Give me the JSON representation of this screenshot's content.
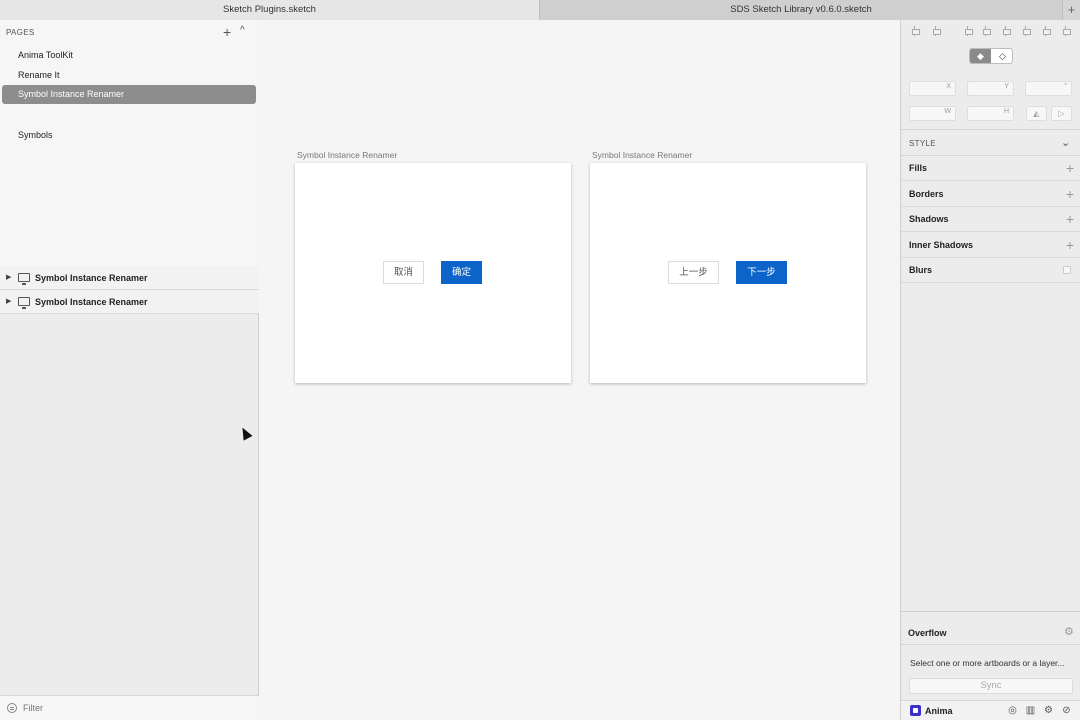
{
  "tabs": [
    {
      "label": "Sketch Plugins.sketch"
    },
    {
      "label": "SDS Sketch Library v0.6.0.sketch"
    }
  ],
  "tab_add": "+",
  "left_panel": {
    "pages_header": "PAGES",
    "pages_add": "+",
    "pages_collapse": "^",
    "pages": [
      {
        "label": "Anima ToolKit"
      },
      {
        "label": "Rename It"
      },
      {
        "label": "Symbol Instance Renamer",
        "selected": true
      },
      {
        "label": "Symbols"
      }
    ],
    "layers": [
      {
        "label": "Symbol Instance Renamer"
      },
      {
        "label": "Symbol Instance Renamer"
      }
    ],
    "filter_placeholder": "Filter"
  },
  "canvas": {
    "artboards": [
      {
        "title": "Symbol Instance Renamer",
        "secondary_label": "取消",
        "primary_label": "确定"
      },
      {
        "title": "Symbol Instance Renamer",
        "secondary_label": "上一步",
        "primary_label": "下一步"
      }
    ]
  },
  "inspector": {
    "fields": {
      "x": "X",
      "y": "Y",
      "rotation": "°",
      "w": "W",
      "h": "H"
    },
    "style_header": "STYLE",
    "sections": [
      {
        "label": "Fills",
        "action": "+"
      },
      {
        "label": "Borders",
        "action": "+"
      },
      {
        "label": "Shadows",
        "action": "+"
      },
      {
        "label": "Inner Shadows",
        "action": "+"
      },
      {
        "label": "Blurs",
        "action": ""
      }
    ],
    "overflow": {
      "title": "Overflow",
      "message": "Select one or more artboards or a layer...",
      "sync_label": "Sync"
    },
    "anima_label": "Anima"
  },
  "colors": {
    "primary": "#0c64c8",
    "selected_page": "#8d8d8d",
    "anima": "#3b2fc9"
  }
}
